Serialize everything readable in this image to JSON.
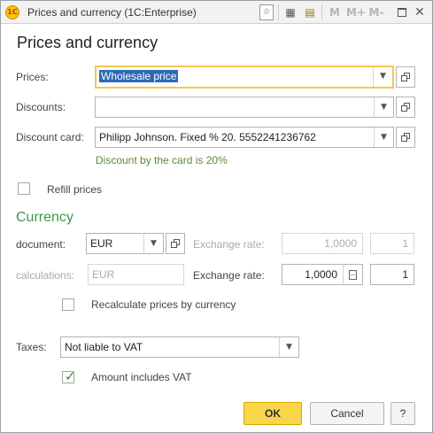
{
  "window": {
    "title": "Prices and currency  (1C:Enterprise)",
    "logo_text": "1С",
    "toolbar": {
      "favorite_icon": "star-icon",
      "calc_icon": "calculator-icon",
      "calendar_icon": "calendar-icon",
      "m_label": "M",
      "mplus_label": "M+",
      "mminus_label": "M-",
      "restore_icon": "window-icon",
      "close_icon": "close-icon"
    }
  },
  "form": {
    "heading": "Prices and currency",
    "prices": {
      "label": "Prices:",
      "value": "Wholesale price"
    },
    "discounts": {
      "label": "Discounts:",
      "value": ""
    },
    "discount_card": {
      "label": "Discount card:",
      "value": "Philipp Johnson. Fixed % 20. 5552241236762",
      "hint": "Discount by the card is 20%"
    },
    "refill_prices": {
      "label": "Refill prices",
      "checked": false
    },
    "currency": {
      "title": "Currency",
      "document": {
        "label": "document:",
        "currency": "EUR",
        "rate_label": "Exchange rate:",
        "rate": "1,0000",
        "multiplicity": "1"
      },
      "calculations": {
        "label": "calculations:",
        "currency": "EUR",
        "rate_label": "Exchange rate:",
        "rate": "1,0000",
        "multiplicity": "1"
      },
      "recalculate": {
        "label": "Recalculate prices by currency",
        "checked": false
      }
    },
    "taxes": {
      "label": "Taxes:",
      "value": "Not liable to VAT"
    },
    "amount_includes_vat": {
      "label": "Amount includes VAT",
      "checked": true
    }
  },
  "buttons": {
    "ok": "OK",
    "cancel": "Cancel",
    "help": "?"
  },
  "colors": {
    "accent_yellow": "#f9d54a",
    "section_green": "#3e9a4a",
    "selection_blue": "#2d6ab5"
  }
}
